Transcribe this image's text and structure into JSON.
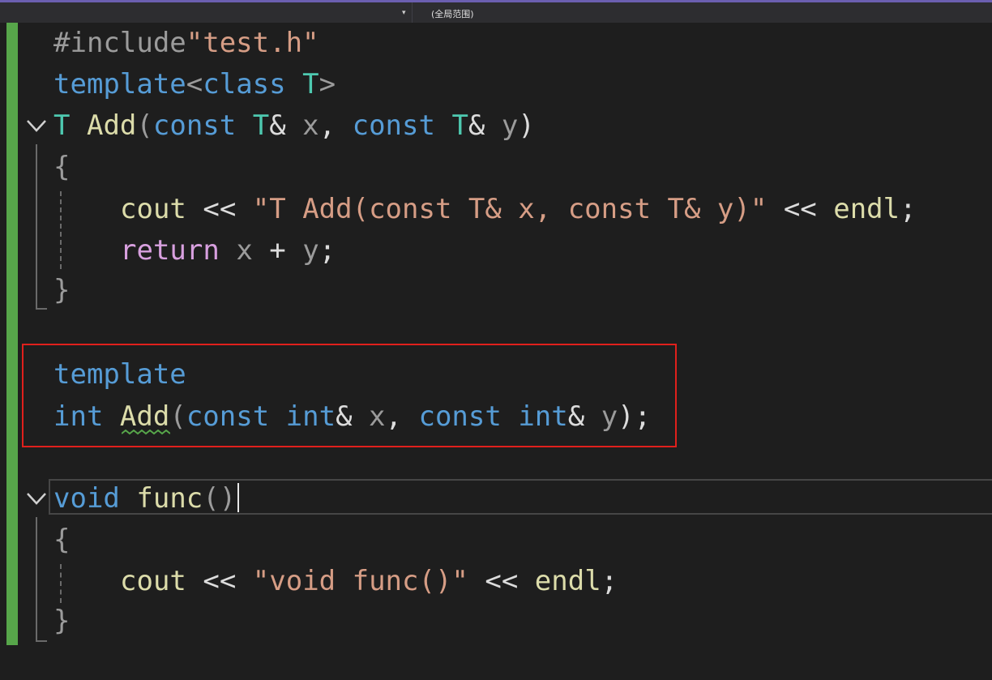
{
  "toolbar": {
    "dropdown_arrow": "▾",
    "scope_label": "(全局范围)"
  },
  "code": {
    "l1": {
      "a": "#include",
      "b": "\"test.h\""
    },
    "l2": {
      "a": "template",
      "b": "<",
      "c": "class",
      "d": " ",
      "e": "T",
      "f": ">"
    },
    "l3": {
      "a": "T",
      "b": " ",
      "c": "Add",
      "d": "(",
      "e": "const",
      "f": " ",
      "g": "T",
      "h": "& ",
      "i": "x",
      "j": ", ",
      "k": "const",
      "l": " ",
      "m": "T",
      "n": "& ",
      "o": "y",
      "p": ")"
    },
    "l4": {
      "a": "{"
    },
    "l5": {
      "a": "cout",
      "b": " << ",
      "c": "\"T Add(const T& x, const T& y)\"",
      "d": " << ",
      "e": "endl",
      "f": ";"
    },
    "l6": {
      "a": "return",
      "b": " ",
      "c": "x",
      "d": " + ",
      "e": "y",
      "f": ";"
    },
    "l7": {
      "a": "}"
    },
    "l8": {
      "a": "template"
    },
    "l9": {
      "a": "int",
      "b": " ",
      "c": "Add",
      "d": "(",
      "e": "const",
      "f": " ",
      "g": "int",
      "h": "& ",
      "i": "x",
      "j": ", ",
      "k": "const",
      "l": " ",
      "m": "int",
      "n": "& ",
      "o": "y",
      "p": ");"
    },
    "l10": {
      "a": "void",
      "b": " ",
      "c": "func",
      "d": "()"
    },
    "l11": {
      "a": "{"
    },
    "l12": {
      "a": "cout",
      "b": " << ",
      "c": "\"void func()\"",
      "d": " << ",
      "e": "endl",
      "f": ";"
    },
    "l13": {
      "a": "}"
    }
  },
  "colors": {
    "keyword": "#569cd6",
    "type": "#4ec9b0",
    "function": "#dcdcaa",
    "string": "#d69d85",
    "control": "#d8a0df",
    "highlight_box": "#e0201c",
    "change_bar": "#57a64a"
  }
}
